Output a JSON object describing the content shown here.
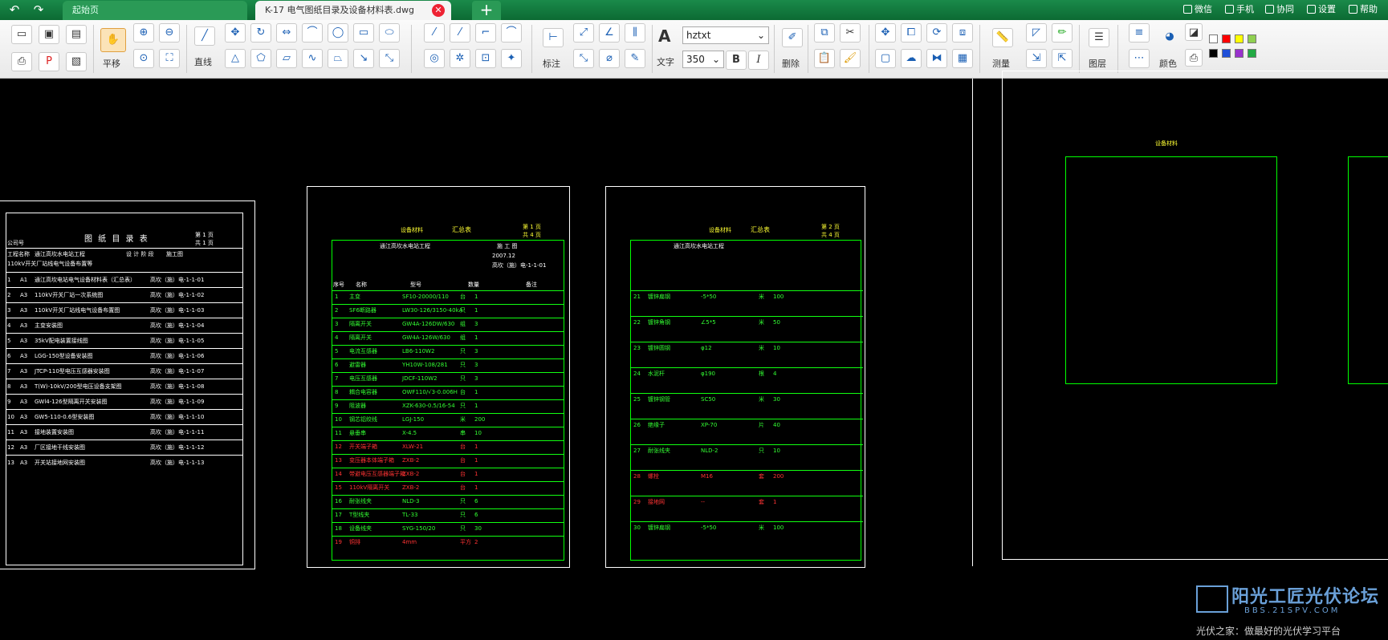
{
  "titlebar": {
    "back_icon": "undo-arrow-icon",
    "forward_icon": "redo-arrow-icon",
    "home_tab": "起始页",
    "active_tab": "K-17 电气图纸目录及设备材料表.dwg",
    "right_items": [
      "微信",
      "手机",
      "协同",
      "设置",
      "帮助"
    ]
  },
  "toolbar": {
    "pan_label": "平移",
    "line_label": "直线",
    "annotate_label": "标注",
    "text_label": "文字",
    "font_value": "hztxt",
    "size_value": "350",
    "bold_label": "B",
    "italic_label": "I",
    "delete_label": "删除",
    "measure_label": "测量",
    "layer_label": "图层",
    "color_label": "颜色",
    "swatches": [
      "#ffffff",
      "#ff0000",
      "#ffff00",
      "#90d050",
      "#000000",
      "#1f4fd8",
      "#9932cc",
      "#22aa44"
    ]
  },
  "sheet1": {
    "title": "图 纸 目 录 表",
    "left_head": "公司号",
    "page_a": "第 1 页",
    "page_b": "共 1 页",
    "proj_label": "工程名称",
    "proj_value": "通江高坎水电站工程",
    "design_label": "设 计 阶 段",
    "design_value": "施工图",
    "row2": "110kV开关厂站线电气设备布置等",
    "rows": [
      [
        "1",
        "A1",
        "通江高坎电站电气设备材料表（汇总表）",
        "高坎（施）电-1-1-01"
      ],
      [
        "2",
        "A3",
        "110kV开关厂站一次系统图",
        "高坎（施）电-1-1-02"
      ],
      [
        "3",
        "A3",
        "110kV开关厂站线电气设备布置图",
        "高坎（施）电-1-1-03"
      ],
      [
        "4",
        "A3",
        "主变安装图",
        "高坎（施）电-1-1-04"
      ],
      [
        "5",
        "A3",
        "35kV配电装置接线图",
        "高坎（施）电-1-1-05"
      ],
      [
        "6",
        "A3",
        "LGG-150型设备安装图",
        "高坎（施）电-1-1-06"
      ],
      [
        "7",
        "A3",
        "JTCP-110型电压互感器安装图",
        "高坎（施）电-1-1-07"
      ],
      [
        "8",
        "A3",
        "T(W)-10kV/200型电压设备支架图",
        "高坎（施）电-1-1-08"
      ],
      [
        "9",
        "A3",
        "GWl4-126型隔离开关安装图",
        "高坎（施）电-1-1-09"
      ],
      [
        "10",
        "A3",
        "GW5-110-0.6型安装图",
        "高坎（施）电-1-1-10"
      ],
      [
        "11",
        "A3",
        "接地装置安装图",
        "高坎（施）电-1-1-11"
      ],
      [
        "12",
        "A3",
        "厂区接地干线安装图",
        "高坎（施）电-1-1-12"
      ],
      [
        "13",
        "A3",
        "开关站接地网安装图",
        "高坎（施）电-1-1-13"
      ]
    ]
  },
  "sheet2": {
    "head": "设备材料",
    "head2": "汇总表",
    "page_a": "第 1 页",
    "page_b": "共 4 页",
    "proj_value": "通江高坎水电站工程",
    "stage_value": "施 工 图",
    "date_value": "2007.12",
    "drawing_no": "高坎（施）电-1-1-01",
    "col_no": "序号",
    "col_name": "名称",
    "col_model": "型号",
    "col_qty": "数量",
    "col_note": "备注",
    "items": [
      [
        "1",
        "主变",
        "SF10-20000/110",
        "台",
        "1",
        "#3f3"
      ],
      [
        "2",
        "SF6断路器",
        "LW30-126/3150-40kA",
        "只",
        "1",
        "#3f3"
      ],
      [
        "3",
        "隔离开关",
        "GW4A-126DW/630",
        "组",
        "3",
        "#3f3"
      ],
      [
        "4",
        "隔离开关",
        "GW4A-126W/630",
        "组",
        "1",
        "#3f3"
      ],
      [
        "5",
        "电流互感器",
        "LB6-110W2",
        "只",
        "3",
        "#3f3"
      ],
      [
        "6",
        "避雷器",
        "YH10W-108/281",
        "只",
        "3",
        "#3f3"
      ],
      [
        "7",
        "电压互感器",
        "JDCF-110W2",
        "只",
        "3",
        "#3f3"
      ],
      [
        "8",
        "耦合电容器",
        "OWF110/√3-0.006H",
        "台",
        "1",
        "#3f3"
      ],
      [
        "9",
        "阻波器",
        "XZK-630-0.5/16-54",
        "只",
        "1",
        "#3f3"
      ],
      [
        "10",
        "钢芯铝绞线",
        "LGJ-150",
        "米",
        "200",
        "#3f3"
      ],
      [
        "11",
        "悬垂串",
        "X-4.5",
        "串",
        "10",
        "#3f3"
      ],
      [
        "12",
        "开关端子箱",
        "XLW-21",
        "台",
        "1",
        "#f33"
      ],
      [
        "13",
        "变压器本体端子箱",
        "ZXB-2",
        "台",
        "1",
        "#f33"
      ],
      [
        "14",
        "带避电压互感器端子箱",
        "ZXB-2",
        "台",
        "1",
        "#f33"
      ],
      [
        "15",
        "110kV隔离开关",
        "ZXB-2",
        "台",
        "1",
        "#f33"
      ],
      [
        "16",
        "耐张线夹",
        "NLD-3",
        "只",
        "6",
        "#3f3"
      ],
      [
        "17",
        "T型线夹",
        "TL-33",
        "只",
        "6",
        "#3f3"
      ],
      [
        "18",
        "设备线夹",
        "SYG-150/20",
        "只",
        "30",
        "#3f3"
      ],
      [
        "19",
        "铜排",
        "4mm",
        "平方",
        "2",
        "#f33"
      ]
    ]
  },
  "sheet3": {
    "head": "设备材料",
    "head2": "汇总表",
    "page_a": "第 2 页",
    "page_b": "共 4 页",
    "proj_value": "通江高坎水电站工程",
    "items": [
      [
        "21",
        "镀锌扁钢",
        "-5*50",
        "米",
        "100",
        "#3f3"
      ],
      [
        "22",
        "镀锌角钢",
        "∠5*5",
        "米",
        "50",
        "#3f3"
      ],
      [
        "23",
        "镀锌圆钢",
        "φ12",
        "米",
        "10",
        "#3f3"
      ],
      [
        "24",
        "水泥杆",
        "φ190",
        "根",
        "4",
        "#3f3"
      ],
      [
        "25",
        "镀锌钢管",
        "SC50",
        "米",
        "30",
        "#3f3"
      ],
      [
        "26",
        "绝缘子",
        "XP-70",
        "片",
        "40",
        "#3f3"
      ],
      [
        "27",
        "耐张线夹",
        "NLD-2",
        "只",
        "10",
        "#3f3"
      ],
      [
        "28",
        "螺栓",
        "M16",
        "套",
        "200",
        "#f33"
      ],
      [
        "29",
        "接地网",
        "--",
        "套",
        "1",
        "#f33"
      ],
      [
        "30",
        "镀锌扁钢",
        "-5*50",
        "米",
        "100",
        "#3f3"
      ]
    ]
  },
  "sheet4": {
    "head": "设备材料"
  },
  "watermark": {
    "brand": "阳光工匠光伏论坛",
    "url": "BBS.21SPV.COM",
    "slogan": "光伏之家：做最好的光伏学习平台"
  }
}
